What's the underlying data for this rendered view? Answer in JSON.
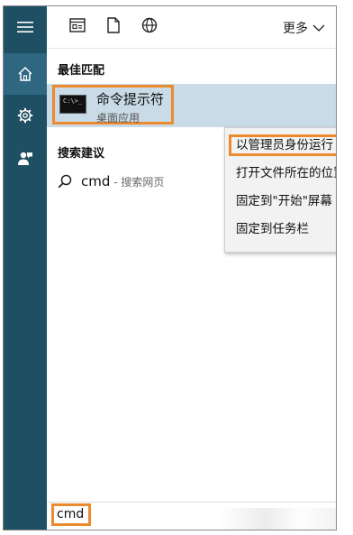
{
  "colors": {
    "sidebar": "#1f4f63",
    "sidebar_active": "#2f6780",
    "selected_row": "#c9dbe7",
    "highlight": "#ec8a2f"
  },
  "sidebar": {
    "items": [
      {
        "icon": "hamburger-menu-icon"
      },
      {
        "icon": "home-icon"
      },
      {
        "icon": "gear-icon"
      },
      {
        "icon": "user-feedback-icon"
      }
    ]
  },
  "topbar": {
    "icons": [
      "apps-icon",
      "documents-icon",
      "web-icon"
    ],
    "more_label": "更多"
  },
  "best_match": {
    "heading": "最佳匹配",
    "app_name": "命令提示符",
    "app_type": "桌面应用",
    "icon_prompt": "C:\\>_"
  },
  "suggestions": {
    "heading": "搜索建议",
    "query": "cmd",
    "hint": " - 搜索网页"
  },
  "context_menu": {
    "items": [
      {
        "label": "以管理员身份运行"
      },
      {
        "label": "打开文件所在的位置"
      },
      {
        "label": "固定到\"开始\"屏幕"
      },
      {
        "label": "固定到任务栏"
      }
    ]
  },
  "search": {
    "value": "cmd"
  }
}
